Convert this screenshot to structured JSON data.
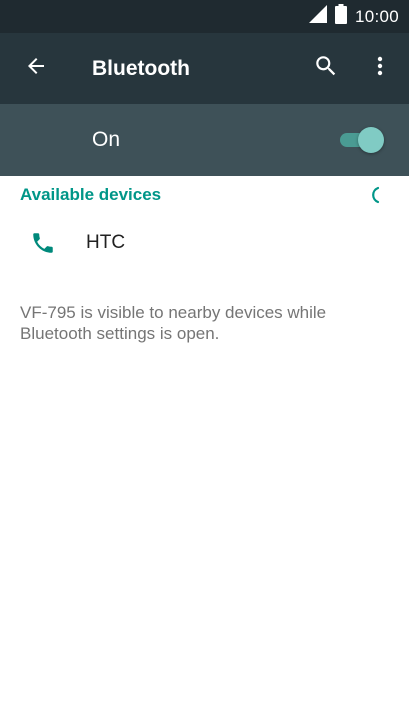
{
  "status_bar": {
    "time": "10:00",
    "icons": [
      "signal-icon",
      "battery-icon"
    ]
  },
  "app_bar": {
    "title": "Bluetooth",
    "back_icon": "back-arrow-icon",
    "search_icon": "search-icon",
    "more_icon": "more-vert-icon"
  },
  "toggle": {
    "label": "On",
    "state": "on"
  },
  "available": {
    "header": "Available devices",
    "devices": [
      {
        "name": "HTC",
        "icon": "phone-icon"
      }
    ]
  },
  "note": "VF-795 is visible to nearby devices while Bluetooth settings is open.",
  "colors": {
    "status_bar": "#1f2a30",
    "app_bar": "#27363d",
    "toggle_bar": "#3e5158",
    "accent": "#009688",
    "switch_thumb": "#80cbc4",
    "switch_track": "#4a9b93"
  }
}
